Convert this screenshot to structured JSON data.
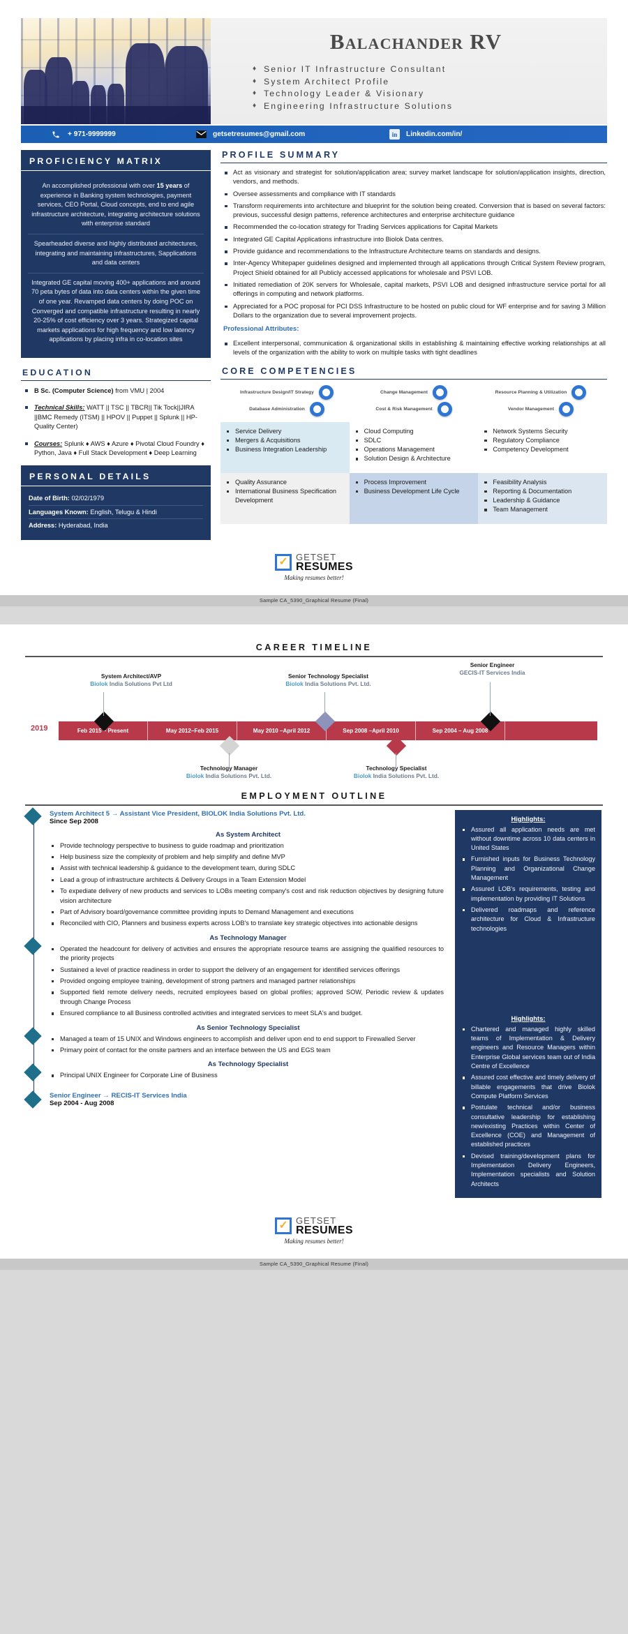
{
  "header": {
    "name": "Balachander RV",
    "taglines": [
      "Senior IT Infrastructure Consultant",
      "System Architect Profile",
      "Technology Leader & Visionary",
      "Engineering Infrastructure Solutions"
    ],
    "contact": {
      "phone": "+ 971-9999999",
      "email": "getsetresumes@gmail.com",
      "linkedin": "Linkedin.com/in/",
      "phone_icon": "phone-icon",
      "email_icon": "envelope-icon",
      "linkedin_icon": "linkedin-icon"
    }
  },
  "proficiency": {
    "title": "PROFICIENCY MATRIX",
    "paragraphs": [
      "An accomplished professional with over 15 years of experience in Banking system technologies, payment services, CEO Portal, Cloud concepts, end to end agile infrastructure architecture, integrating architecture solutions with enterprise standard",
      "Spearheaded diverse and highly distributed architectures, integrating and maintaining infrastructures, Sapplications and data centers",
      "Integrated GE capital moving 400+ applications and around 70 peta bytes of data into data centers within the given time of one year. Revamped data centers by doing POC on Converged and compatible infrastructure resulting in nearly 20-25% of cost efficiency over 3 years. Strategized capital markets applications for high frequency and low latency applications by placing infra in co-location sites"
    ]
  },
  "education": {
    "title": "EDUCATION",
    "items": [
      {
        "lead": "B Sc. (Computer Science)",
        "rest": " from VMU | 2004",
        "underline": false
      },
      {
        "lead": "Technical Skills:",
        "rest": " WATT || TSC || TBCR|| Tik Tock||JIRA ||BMC Remedy (ITSM) || HPOV || Puppet || Splunk || HP-Quality Center)",
        "underline": true
      },
      {
        "lead": "Courses:",
        "rest": " Splunk ♦ AWS ♦ Azure ♦ Pivotal Cloud Foundry ♦ Python, Java ♦ Full Stack Development ♦ Deep Learning",
        "underline": true
      }
    ]
  },
  "personal": {
    "title": "PERSONAL DETAILS",
    "rows": [
      {
        "label": "Date of Birth:",
        "value": " 02/02/1979"
      },
      {
        "label": "Languages Known:",
        "value": " English, Telugu & Hindi"
      },
      {
        "label": "Address:",
        "value": " Hyderabad, India"
      }
    ]
  },
  "profile": {
    "title": "PROFILE SUMMARY",
    "bullets": [
      "Act as visionary and strategist for solution/application area; survey market landscape for solution/application insights, direction, vendors, and methods.",
      "Oversee assessments and compliance with IT standards",
      "Transform requirements into architecture and blueprint for the solution being created. Conversion that is based on several factors: previous, successful design patterns, reference architectures and enterprise architecture guidance",
      "Recommended the co-location strategy for Trading Services applications for Capital Markets",
      "Integrated GE Capital Applications infrastructure into Biolok Data centres.",
      "Provide guidance and recommendations to the Infrastructure Architecture teams on standards and designs.",
      "Inter-Agency Whitepaper guidelines designed and implemented through all applications through Critical System Review program, Project Shield obtained for all Publicly accessed applications for wholesale and PSVI LOB.",
      "Initiated remediation of 20K servers for Wholesale, capital markets, PSVI LOB and designed infrastructure service portal for all offerings in computing and network platforms.",
      "Appreciated for a POC proposal for PCI DSS Infrastructure to be hosted on public cloud for WF enterprise and for saving 3 Million Dollars to the organization due to several improvement projects."
    ],
    "attributes_title": "Professional Attributes:",
    "attributes": [
      "Excellent interpersonal, communication & organizational skills in establishing & maintaining effective working relationships at all levels of the organization with the ability to work on multiple tasks with tight deadlines"
    ]
  },
  "competencies": {
    "title": "CORE COMPETENCIES",
    "ring_labels": [
      "Infrastructure Design/IT Strategy",
      "Change Management",
      "Resource Planning & Utilization",
      "Database Administration",
      "Cost & Risk Management",
      "Vendor Management"
    ],
    "cells": [
      [
        "Service Delivery",
        "Mergers & Acquisitions",
        "Business Integration Leadership"
      ],
      [
        "Cloud Computing",
        "SDLC",
        "Operations Management",
        "Solution Design & Architecture"
      ],
      [
        "Network Systems Security",
        "Regulatory Compliance",
        "Competency Development"
      ],
      [
        "Quality Assurance",
        "International Business Specification Development"
      ],
      [
        "Process Improvement",
        "Business Development Life Cycle"
      ],
      [
        "Feasibility Analysis",
        "Reporting & Documentation",
        "Leadership & Guidance",
        "Team Management"
      ]
    ]
  },
  "footer": {
    "logo_top": "GETSET",
    "logo_bottom": "RESUMES",
    "tagline": "Making resumes better!",
    "caption": "Sample CA_5390_Graphical Resume (Final)"
  },
  "timeline": {
    "title": "CAREER TIMELINE",
    "year": "2019",
    "segments": [
      "Feb 2015 – Present",
      "May 2012–Feb 2015",
      "May 2010 –April 2012",
      "Sep 2008 –April 2010",
      "Sep 2004 – Aug 2008"
    ],
    "above": [
      {
        "role": "System Architect/AVP",
        "company": "Biolok India Solutions Pvt Ltd",
        "diamond": "#111111"
      },
      {
        "role": "Senior Technology Specialist",
        "company": "Biolok India Solutions Pvt. Ltd.",
        "diamond": "#8e93bb"
      },
      {
        "role": "Senior Engineer",
        "company": "GECIS-IT Services India",
        "diamond": "#111111"
      }
    ],
    "below": [
      {
        "role": "Technology Manager",
        "company": "Biolok India Solutions Pvt. Ltd.",
        "diamond": "#d4d4d4"
      },
      {
        "role": "Technology Specialist",
        "company": "Biolok India Solutions Pvt. Ltd.",
        "diamond": "#b8394a"
      }
    ]
  },
  "employment": {
    "title": "EMPLOYMENT OUTLINE",
    "entries": [
      {
        "title": "System Architect 5 → Assistant Vice President, BIOLOK India Solutions Pvt. Ltd.",
        "date": "Since Sep 2008",
        "role": "As System Architect",
        "bullets": [
          "Provide technology perspective to business to guide roadmap and prioritization",
          "Help business size the complexity of problem and help simplify and define MVP",
          "Assist with technical leadership & guidance to the development team, during SDLC",
          "Lead a group of infrastructure architects & Delivery Groups in a Team Extension Model",
          "To expediate delivery of new products and services to LOBs meeting company's cost and risk reduction objectives by designing future vision architecture",
          "Part of Advisory board/governance committee providing inputs to Demand Management and executions",
          "Reconciled with CIO, Planners and business experts across LOB's to translate key strategic objectives into actionable designs"
        ]
      },
      {
        "title": "",
        "date": "",
        "role": "As Technology Manager",
        "bullets": [
          "Operated the headcount for delivery of activities and ensures the appropriate resource teams are assigning the qualified resources to the priority projects",
          "Sustained a level of practice readiness in order to support the delivery of an engagement for identified services offerings",
          "Provided ongoing employee training, development of strong partners and managed partner relationships",
          "Supported field remote delivery needs, recruited employees based on global profiles; approved SOW, Periodic review & updates through Change Process",
          "Ensured compliance to all Business controlled activities and integrated services to meet SLA's and budget."
        ]
      },
      {
        "title": "",
        "date": "",
        "role": "As Senior Technology Specialist",
        "bullets": [
          "Managed a team of 15 UNIX and Windows engineers to accomplish and deliver upon end to end support to Firewalled Server",
          "Primary point of contact for the onsite partners and an interface between the US and EGS team"
        ]
      },
      {
        "title": "",
        "date": "",
        "role": "As Technology Specialist",
        "bullets": [
          "Principal UNIX Engineer for Corporate Line of Business"
        ]
      }
    ],
    "last_entry": {
      "title": "Senior Engineer → RECIS-IT Services India",
      "date": "Sep 2004 - Aug 2008"
    },
    "highlights": [
      {
        "title": "Highlights:",
        "bullets": [
          "Assured all application needs are met without downtime across 10 data centers in United States",
          "Furnished inputs for Business Technology Planning and Organizational Change Management",
          "Assured LOB's requirements, testing and implementation by providing IT Solutions",
          "Delivered roadmaps and reference architecture for Cloud & Infrastructure technologies"
        ]
      },
      {
        "title": "Highlights:",
        "bullets": [
          "Chartered and managed highly skilled teams of Implementation & Delivery engineers and Resource Managers within Enterprise Global services team out of India Centre of Excellence",
          "Assured cost effective and timely delivery of billable engagements that drive Biolok Compute Platform Services",
          "Postulate technical and/or business consultative leadership for establishing new/existing Practices within Center of Excellence (COE) and Management of established practices",
          "Devised training/development plans for Implementation Delivery Engineers, Implementation specialists and Solution Architects"
        ]
      }
    ]
  }
}
